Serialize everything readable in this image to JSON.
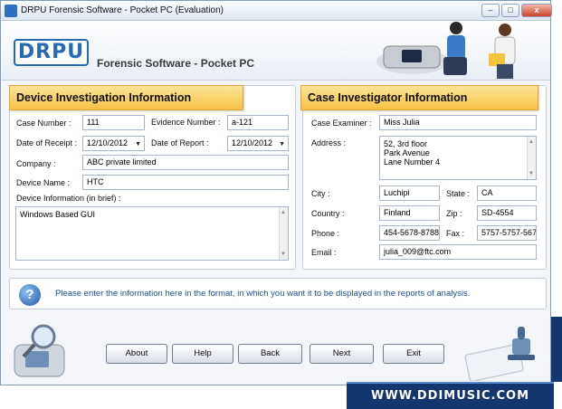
{
  "window": {
    "title": "DRPU Forensic Software - Pocket PC (Evaluation)",
    "controls": {
      "minimize": "–",
      "maximize": "□",
      "close": "x"
    }
  },
  "header": {
    "logo": "DRPU",
    "product_name": "Forensic Software - Pocket PC"
  },
  "device_section": {
    "title": "Device Investigation Information",
    "case_number_label": "Case Number :",
    "case_number": "111",
    "evidence_number_label": "Evidence Number :",
    "evidence_number": "a-121",
    "date_of_receipt_label": "Date of Receipt :",
    "date_of_receipt": "12/10/2012",
    "date_of_report_label": "Date of Report :",
    "date_of_report": "12/10/2012",
    "company_label": "Company :",
    "company": "ABC private limited",
    "device_name_label": "Device Name :",
    "device_name": "HTC",
    "device_info_label": "Device Information (in brief) :",
    "device_info": "Windows Based GUI"
  },
  "investigator_section": {
    "title": "Case Investigator Information",
    "case_examiner_label": "Case Examiner :",
    "case_examiner": "Miss Julia",
    "address_label": "Address :",
    "address_lines": [
      "52, 3rd floor",
      "Park Avenue",
      "Lane Number 4"
    ],
    "city_label": "City :",
    "city": "Luchipi",
    "state_label": "State :",
    "state": "CA",
    "country_label": "Country :",
    "country": "Finland",
    "zip_label": "Zip :",
    "zip": "SD-4554",
    "phone_label": "Phone :",
    "phone": "454-5678-8788",
    "fax_label": "Fax :",
    "fax": "5757-5757-567",
    "email_label": "Email :",
    "email": "julia_009@ftc.com"
  },
  "info": {
    "icon": "help-question-icon",
    "message": "Please enter the information here in the format, in which you want it to be displayed in the reports of analysis."
  },
  "buttons": {
    "about": "About",
    "help": "Help",
    "back": "Back",
    "next": "Next",
    "exit": "Exit"
  },
  "footer": {
    "website": "WWW.DDIMUSIC.COM"
  },
  "colors": {
    "section_title_bg": "#f7c243",
    "accent_blue": "#2669b4",
    "footer_bg": "#12366e"
  }
}
